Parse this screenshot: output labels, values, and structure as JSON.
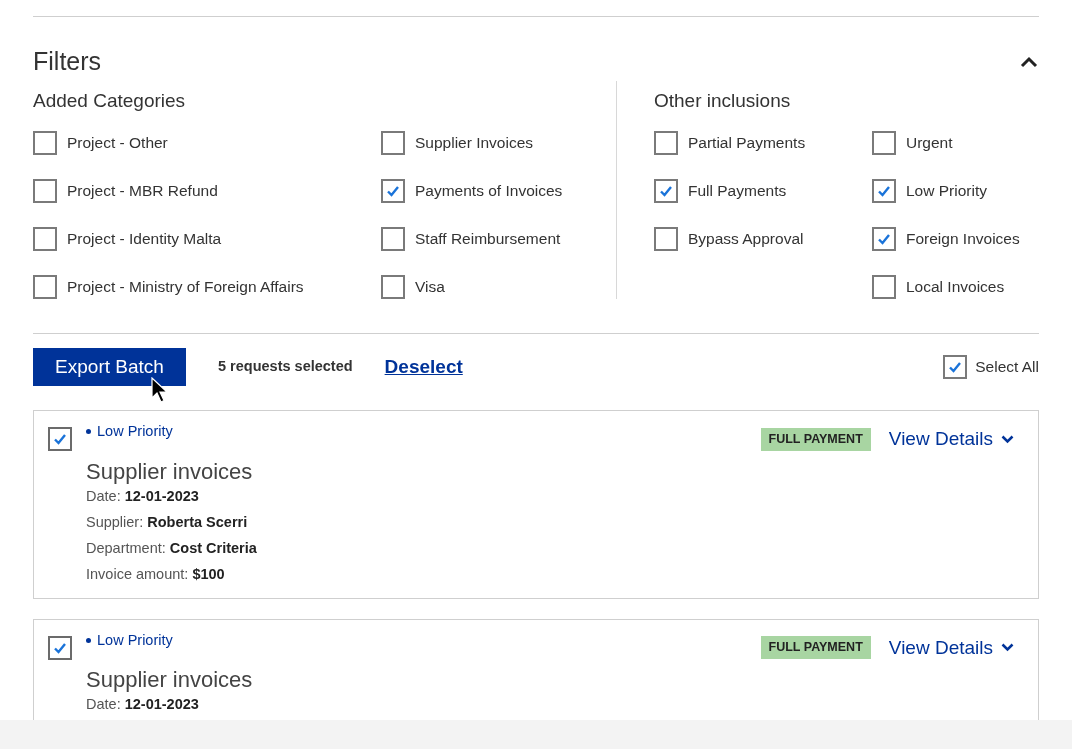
{
  "filters": {
    "title": "Filters",
    "expanded": true,
    "groups": [
      {
        "title": "Added Categories",
        "columns": [
          [
            {
              "label": "Project - Other",
              "checked": false
            },
            {
              "label": "Project - MBR Refund",
              "checked": false
            },
            {
              "label": "Project - Identity Malta",
              "checked": false
            },
            {
              "label": "Project - Ministry of Foreign Affairs",
              "checked": false
            }
          ],
          [
            {
              "label": "Supplier Invoices",
              "checked": false
            },
            {
              "label": "Payments of Invoices",
              "checked": true
            },
            {
              "label": "Staff Reimbursement",
              "checked": false
            },
            {
              "label": "Visa",
              "checked": false
            }
          ]
        ]
      },
      {
        "title": "Other inclusions",
        "columns": [
          [
            {
              "label": "Partial Payments",
              "checked": false
            },
            {
              "label": "Full Payments",
              "checked": true
            },
            {
              "label": "Bypass Approval",
              "checked": false
            }
          ],
          [
            {
              "label": "Urgent",
              "checked": false
            },
            {
              "label": "Low Priority",
              "checked": true
            },
            {
              "label": "Foreign Invoices",
              "checked": true
            },
            {
              "label": "Local Invoices",
              "checked": false
            }
          ]
        ]
      }
    ]
  },
  "actions": {
    "export_button": "Export Batch",
    "selected_count": "5 requests selected",
    "deselect_link": "Deselect",
    "select_all": {
      "label": "Select All",
      "checked": true
    }
  },
  "requests": [
    {
      "checked": true,
      "priority": "Low Priority",
      "badge": "FULL PAYMENT",
      "view_details": "View Details",
      "title": "Supplier invoices",
      "fields": [
        {
          "label": "Date:",
          "value": "12-01-2023"
        },
        {
          "label": "Supplier:",
          "value": "Roberta Scerri"
        },
        {
          "label": "Department:",
          "value": "Cost Criteria"
        },
        {
          "label": "Invoice amount:",
          "value": "$100"
        }
      ]
    },
    {
      "checked": true,
      "priority": "Low Priority",
      "badge": "FULL PAYMENT",
      "view_details": "View Details",
      "title": "Supplier invoices",
      "fields": [
        {
          "label": "Date:",
          "value": "12-01-2023"
        }
      ]
    }
  ]
}
